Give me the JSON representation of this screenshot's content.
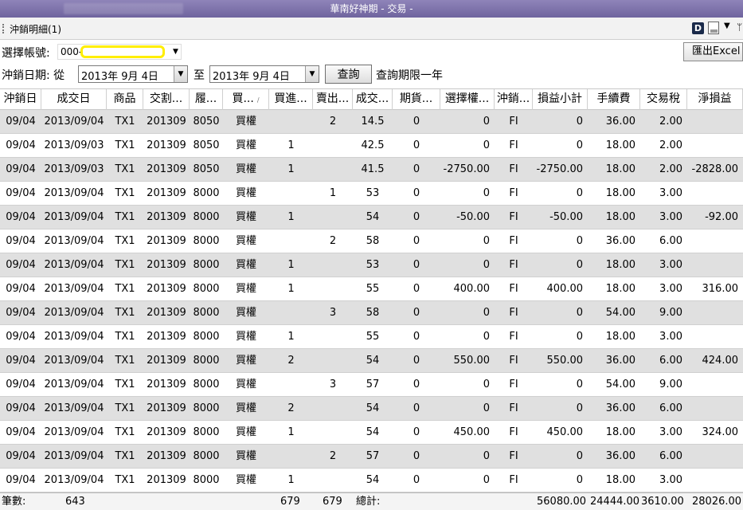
{
  "window": {
    "title": "華南好神期 - 交易 -"
  },
  "tab": {
    "label": "沖銷明細(1)"
  },
  "toolbar": {
    "export_label": "匯出Excel",
    "d_label": "D"
  },
  "filters": {
    "account_label": "選擇帳號:",
    "account_prefix": "000-",
    "date_label": "沖銷日期: 從",
    "date_from": "2013年  9月  4日",
    "to_label": "至",
    "date_to": "2013年  9月  4日",
    "query_label": "查詢",
    "limit_note": "查詢期限一年"
  },
  "columns": [
    "沖銷日",
    "成交日",
    "商品",
    "交割...",
    "履...",
    "買...",
    "買進...",
    "賣出...",
    "成交...",
    "期貨...",
    "選擇權...",
    "沖銷...",
    "損益小計",
    "手續費",
    "交易稅",
    "淨損益"
  ],
  "rows": [
    [
      "09/04",
      "2013/09/04",
      "TX1",
      "201309",
      "8050",
      "買權",
      "",
      "2",
      "14.5",
      "0",
      "0",
      "FI",
      "0",
      "36.00",
      "2.00",
      ""
    ],
    [
      "09/04",
      "2013/09/03",
      "TX1",
      "201309",
      "8050",
      "買權",
      "1",
      "",
      "42.5",
      "0",
      "0",
      "FI",
      "0",
      "18.00",
      "2.00",
      ""
    ],
    [
      "09/04",
      "2013/09/03",
      "TX1",
      "201309",
      "8050",
      "買權",
      "1",
      "",
      "41.5",
      "0",
      "-2750.00",
      "FI",
      "-2750.00",
      "18.00",
      "2.00",
      "-2828.00"
    ],
    [
      "09/04",
      "2013/09/04",
      "TX1",
      "201309",
      "8000",
      "買權",
      "",
      "1",
      "53",
      "0",
      "0",
      "FI",
      "0",
      "18.00",
      "3.00",
      ""
    ],
    [
      "09/04",
      "2013/09/04",
      "TX1",
      "201309",
      "8000",
      "買權",
      "1",
      "",
      "54",
      "0",
      "-50.00",
      "FI",
      "-50.00",
      "18.00",
      "3.00",
      "-92.00"
    ],
    [
      "09/04",
      "2013/09/04",
      "TX1",
      "201309",
      "8000",
      "買權",
      "",
      "2",
      "58",
      "0",
      "0",
      "FI",
      "0",
      "36.00",
      "6.00",
      ""
    ],
    [
      "09/04",
      "2013/09/04",
      "TX1",
      "201309",
      "8000",
      "買權",
      "1",
      "",
      "53",
      "0",
      "0",
      "FI",
      "0",
      "18.00",
      "3.00",
      ""
    ],
    [
      "09/04",
      "2013/09/04",
      "TX1",
      "201309",
      "8000",
      "買權",
      "1",
      "",
      "55",
      "0",
      "400.00",
      "FI",
      "400.00",
      "18.00",
      "3.00",
      "316.00"
    ],
    [
      "09/04",
      "2013/09/04",
      "TX1",
      "201309",
      "8000",
      "買權",
      "",
      "3",
      "58",
      "0",
      "0",
      "FI",
      "0",
      "54.00",
      "9.00",
      ""
    ],
    [
      "09/04",
      "2013/09/04",
      "TX1",
      "201309",
      "8000",
      "買權",
      "1",
      "",
      "55",
      "0",
      "0",
      "FI",
      "0",
      "18.00",
      "3.00",
      ""
    ],
    [
      "09/04",
      "2013/09/04",
      "TX1",
      "201309",
      "8000",
      "買權",
      "2",
      "",
      "54",
      "0",
      "550.00",
      "FI",
      "550.00",
      "36.00",
      "6.00",
      "424.00"
    ],
    [
      "09/04",
      "2013/09/04",
      "TX1",
      "201309",
      "8000",
      "買權",
      "",
      "3",
      "57",
      "0",
      "0",
      "FI",
      "0",
      "54.00",
      "9.00",
      ""
    ],
    [
      "09/04",
      "2013/09/04",
      "TX1",
      "201309",
      "8000",
      "買權",
      "2",
      "",
      "54",
      "0",
      "0",
      "FI",
      "0",
      "36.00",
      "6.00",
      ""
    ],
    [
      "09/04",
      "2013/09/04",
      "TX1",
      "201309",
      "8000",
      "買權",
      "1",
      "",
      "54",
      "0",
      "450.00",
      "FI",
      "450.00",
      "18.00",
      "3.00",
      "324.00"
    ],
    [
      "09/04",
      "2013/09/04",
      "TX1",
      "201309",
      "8000",
      "買權",
      "",
      "2",
      "57",
      "0",
      "0",
      "FI",
      "0",
      "36.00",
      "6.00",
      ""
    ],
    [
      "09/04",
      "2013/09/04",
      "TX1",
      "201309",
      "8000",
      "買權",
      "1",
      "",
      "54",
      "0",
      "0",
      "FI",
      "0",
      "18.00",
      "3.00",
      ""
    ]
  ],
  "footer": {
    "count_label": "筆數:",
    "count_value": "643",
    "buy_total": "679",
    "sell_total": "679",
    "total_label": "總計:",
    "pnl_total": "56080.00",
    "fee_total": "24444.00",
    "tax_total": "3610.00",
    "net_total": "28026.00"
  },
  "colors": {
    "title_bar": "#7a6fae",
    "row_alt": "#e0e0e0",
    "highlight": "#ffee00"
  },
  "icons": [
    "d-icon",
    "document-icon",
    "chevron-down-icon",
    "pin-icon",
    "grip-icon",
    "dropdown-arrow-icon",
    "sort-icon"
  ]
}
